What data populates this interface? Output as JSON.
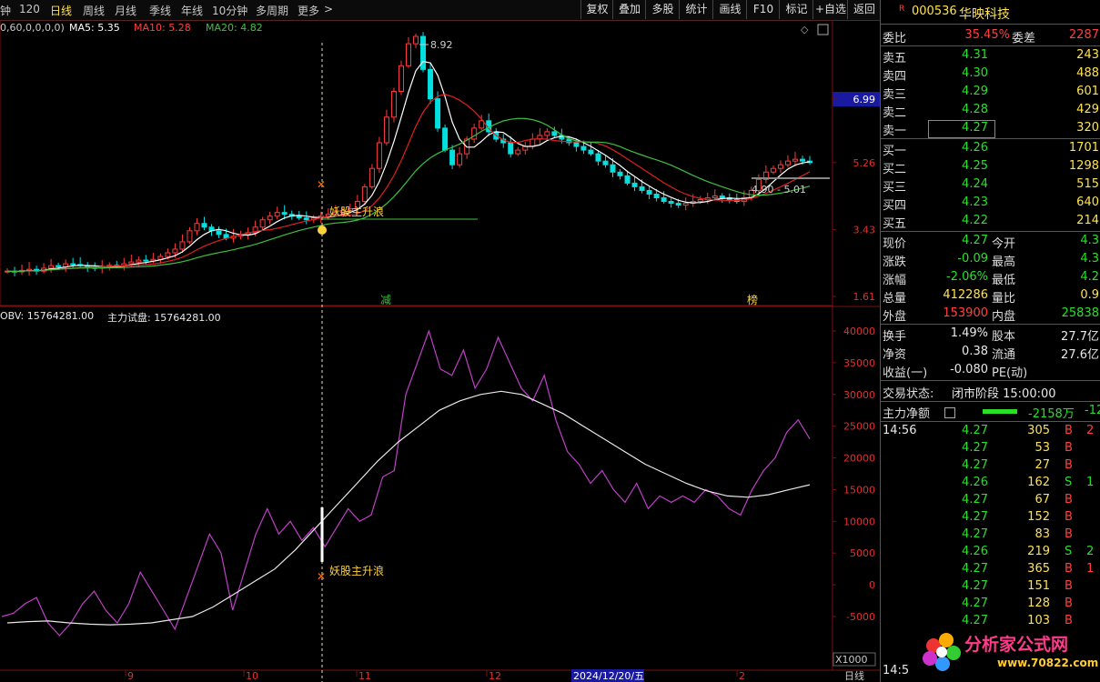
{
  "toolbar": {
    "left_items": [
      "钟",
      "120",
      "日线",
      "周线",
      "月线",
      "季线",
      "年线",
      "10分钟",
      "多周期",
      "更多"
    ],
    "active": "日线",
    "more_arrow": ">",
    "right_items": [
      "复权",
      "叠加",
      "多股",
      "统计",
      "画线",
      "F10",
      "标记",
      "+自选",
      "返回"
    ]
  },
  "legends": {
    "params": "0,60,0,0,0,0)",
    "ma5": "MA5: 5.35",
    "ma10": "MA10: 5.28",
    "ma20": "MA20: 4.82",
    "obv": "OBV: 15764281.00",
    "zl": "主力试盘: 15764281.00"
  },
  "price_axis": {
    "ticks": [
      "6.99",
      "5.26",
      "3.43",
      "1.61"
    ],
    "high_label": "8.92",
    "range_label": "4.90 - 5.01",
    "signal_label": "妖股主升浪",
    "marker_jian": "减",
    "marker_bang": "榜"
  },
  "obv_axis": {
    "ticks": [
      "40000",
      "35000",
      "30000",
      "25000",
      "20000",
      "15000",
      "10000",
      "5000",
      "0",
      "-5000"
    ],
    "unit": "X1000",
    "signal_label": "妖股主升浪"
  },
  "x_axis": {
    "months": [
      "9",
      "10",
      "11",
      "12",
      "2"
    ],
    "date_box": "2024/12/20/五",
    "period": "日线"
  },
  "panel": {
    "code_prefix": "R",
    "code": "000536",
    "name": "华映科技",
    "weibi": {
      "label": "委比",
      "value": "35.45%",
      "label2": "委差",
      "value2": "2287"
    },
    "asks": [
      {
        "label": "卖五",
        "price": "4.31",
        "vol": "243"
      },
      {
        "label": "卖四",
        "price": "4.30",
        "vol": "488"
      },
      {
        "label": "卖三",
        "price": "4.29",
        "vol": "601"
      },
      {
        "label": "卖二",
        "price": "4.28",
        "vol": "429"
      },
      {
        "label": "卖一",
        "price": "4.27",
        "vol": "320"
      }
    ],
    "bids": [
      {
        "label": "买一",
        "price": "4.26",
        "vol": "1701"
      },
      {
        "label": "买二",
        "price": "4.25",
        "vol": "1298"
      },
      {
        "label": "买三",
        "price": "4.24",
        "vol": "515"
      },
      {
        "label": "买四",
        "price": "4.23",
        "vol": "640"
      },
      {
        "label": "买五",
        "price": "4.22",
        "vol": "214"
      }
    ],
    "stats": [
      {
        "l1": "现价",
        "v1": "4.27",
        "c1": "g",
        "l2": "今开",
        "v2": "4.3",
        "c2": "g"
      },
      {
        "l1": "涨跌",
        "v1": "-0.09",
        "c1": "g",
        "l2": "最高",
        "v2": "4.3",
        "c2": "g"
      },
      {
        "l1": "涨幅",
        "v1": "-2.06%",
        "c1": "g",
        "l2": "最低",
        "v2": "4.2",
        "c2": "g"
      },
      {
        "l1": "总量",
        "v1": "412286",
        "c1": "y",
        "l2": "量比",
        "v2": "0.9",
        "c2": "y"
      },
      {
        "l1": "外盘",
        "v1": "153900",
        "c1": "r",
        "l2": "内盘",
        "v2": "25838",
        "c2": "g"
      }
    ],
    "stats2": [
      {
        "l1": "换手",
        "v1": "1.49%",
        "l2": "股本",
        "v2": "27.7亿"
      },
      {
        "l1": "净资",
        "v1": "0.38",
        "l2": "流通",
        "v2": "27.6亿"
      },
      {
        "l1": "收益(一)",
        "v1": "-0.080",
        "l2": "PE(动)",
        "v2": ""
      }
    ],
    "trade_status_label": "交易状态:",
    "trade_status": "闭市阶段 15:00:00",
    "net_label": "主力净额",
    "net_value": "-2158万",
    "net_pct": "-12",
    "ticks": [
      {
        "t": "14:56",
        "p": "4.27",
        "v": "305",
        "s": "B",
        "n": "2"
      },
      {
        "t": "",
        "p": "4.27",
        "v": "53",
        "s": "B",
        "n": ""
      },
      {
        "t": "",
        "p": "4.27",
        "v": "27",
        "s": "B",
        "n": ""
      },
      {
        "t": "",
        "p": "4.26",
        "v": "162",
        "s": "S",
        "n": "1"
      },
      {
        "t": "",
        "p": "4.27",
        "v": "67",
        "s": "B",
        "n": ""
      },
      {
        "t": "",
        "p": "4.27",
        "v": "152",
        "s": "B",
        "n": ""
      },
      {
        "t": "",
        "p": "4.27",
        "v": "83",
        "s": "B",
        "n": ""
      },
      {
        "t": "",
        "p": "4.26",
        "v": "219",
        "s": "S",
        "n": "2"
      },
      {
        "t": "",
        "p": "4.27",
        "v": "365",
        "s": "B",
        "n": "1"
      },
      {
        "t": "",
        "p": "4.27",
        "v": "151",
        "s": "B",
        "n": ""
      },
      {
        "t": "",
        "p": "4.27",
        "v": "128",
        "s": "B",
        "n": ""
      },
      {
        "t": "",
        "p": "4.27",
        "v": "103",
        "s": "B",
        "n": ""
      }
    ],
    "bottom_time": "14:5"
  },
  "watermark": {
    "text": "分析家公式网",
    "url": "www.70822.com"
  },
  "colors": {
    "up": "#ff3b3b",
    "down": "#00e0e0",
    "ma5": "#ffffff",
    "ma10": "#e02020",
    "ma20": "#3fbf3f",
    "obv": "#c040c8",
    "zl": "#e8e8e8",
    "signal": "#ffd23a"
  },
  "chart_data": [
    {
      "type": "candlestick",
      "title": "",
      "ylabel": "",
      "y_ticks": [
        6.99,
        5.26,
        3.43,
        1.61
      ],
      "note": "daily candles with MA5/MA10/MA20; peak 8.92",
      "closes": [
        2.3,
        2.28,
        2.32,
        2.35,
        2.3,
        2.38,
        2.45,
        2.42,
        2.5,
        2.48,
        2.45,
        2.4,
        2.38,
        2.42,
        2.46,
        2.44,
        2.5,
        2.55,
        2.6,
        2.58,
        2.62,
        2.7,
        2.8,
        2.9,
        3.1,
        3.4,
        3.6,
        3.5,
        3.4,
        3.3,
        3.2,
        3.25,
        3.3,
        3.35,
        3.5,
        3.7,
        3.8,
        3.9,
        3.85,
        3.8,
        3.75,
        3.7,
        3.75,
        3.8,
        3.85,
        3.9,
        3.95,
        4.0,
        4.2,
        4.6,
        5.1,
        5.8,
        6.5,
        7.2,
        7.9,
        8.5,
        8.7,
        7.8,
        7.0,
        6.2,
        5.6,
        5.2,
        5.5,
        5.9,
        6.2,
        6.4,
        6.1,
        5.9,
        5.8,
        5.5,
        5.6,
        5.7,
        5.9,
        6.0,
        6.1,
        6.0,
        5.9,
        5.8,
        5.7,
        5.6,
        5.5,
        5.3,
        5.2,
        5.0,
        4.9,
        4.7,
        4.6,
        4.5,
        4.4,
        4.3,
        4.2,
        4.15,
        4.1,
        4.15,
        4.2,
        4.25,
        4.3,
        4.35,
        4.3,
        4.25,
        4.2,
        4.3,
        4.5,
        4.8,
        5.0,
        5.1,
        5.2,
        5.3,
        5.35,
        5.3,
        5.26
      ],
      "ma5": 5.35,
      "ma10": 5.28,
      "ma20": 4.82
    },
    {
      "type": "line",
      "title": "",
      "series": [
        {
          "name": "OBV",
          "values": [
            -5000,
            -4500,
            -3000,
            -2000,
            -6000,
            -8000,
            -6000,
            -3000,
            -1000,
            -4000,
            -6000,
            -3000,
            2000,
            -1000,
            -4000,
            -7000,
            -2000,
            3000,
            8000,
            5000,
            -4000,
            2000,
            8000,
            12000,
            8000,
            10000,
            7000,
            9000,
            6000,
            9000,
            12000,
            10000,
            11000,
            17000,
            18000,
            30000,
            35000,
            40000,
            34000,
            33000,
            37000,
            31000,
            34000,
            39000,
            35000,
            31000,
            29000,
            33000,
            26000,
            21000,
            19000,
            16000,
            18000,
            15000,
            13000,
            16000,
            12000,
            14000,
            13000,
            14000,
            13000,
            15000,
            14000,
            12000,
            11000,
            15000,
            18000,
            20000,
            24000,
            26000,
            23000
          ]
        },
        {
          "name": "主力试盘",
          "values": [
            -6000,
            -5800,
            -5700,
            -6000,
            -6200,
            -6300,
            -6200,
            -6000,
            -5500,
            -5000,
            -3500,
            -1500,
            500,
            2500,
            5500,
            9000,
            12500,
            16000,
            19500,
            22500,
            25000,
            27500,
            29000,
            30000,
            30500,
            30000,
            28500,
            27000,
            25000,
            23000,
            21000,
            19000,
            17500,
            16000,
            14800,
            14000,
            13800,
            14200,
            15000,
            15764
          ]
        }
      ],
      "y_ticks": [
        40000,
        35000,
        30000,
        25000,
        20000,
        15000,
        10000,
        5000,
        0,
        -5000
      ],
      "unit": "X1000"
    }
  ]
}
